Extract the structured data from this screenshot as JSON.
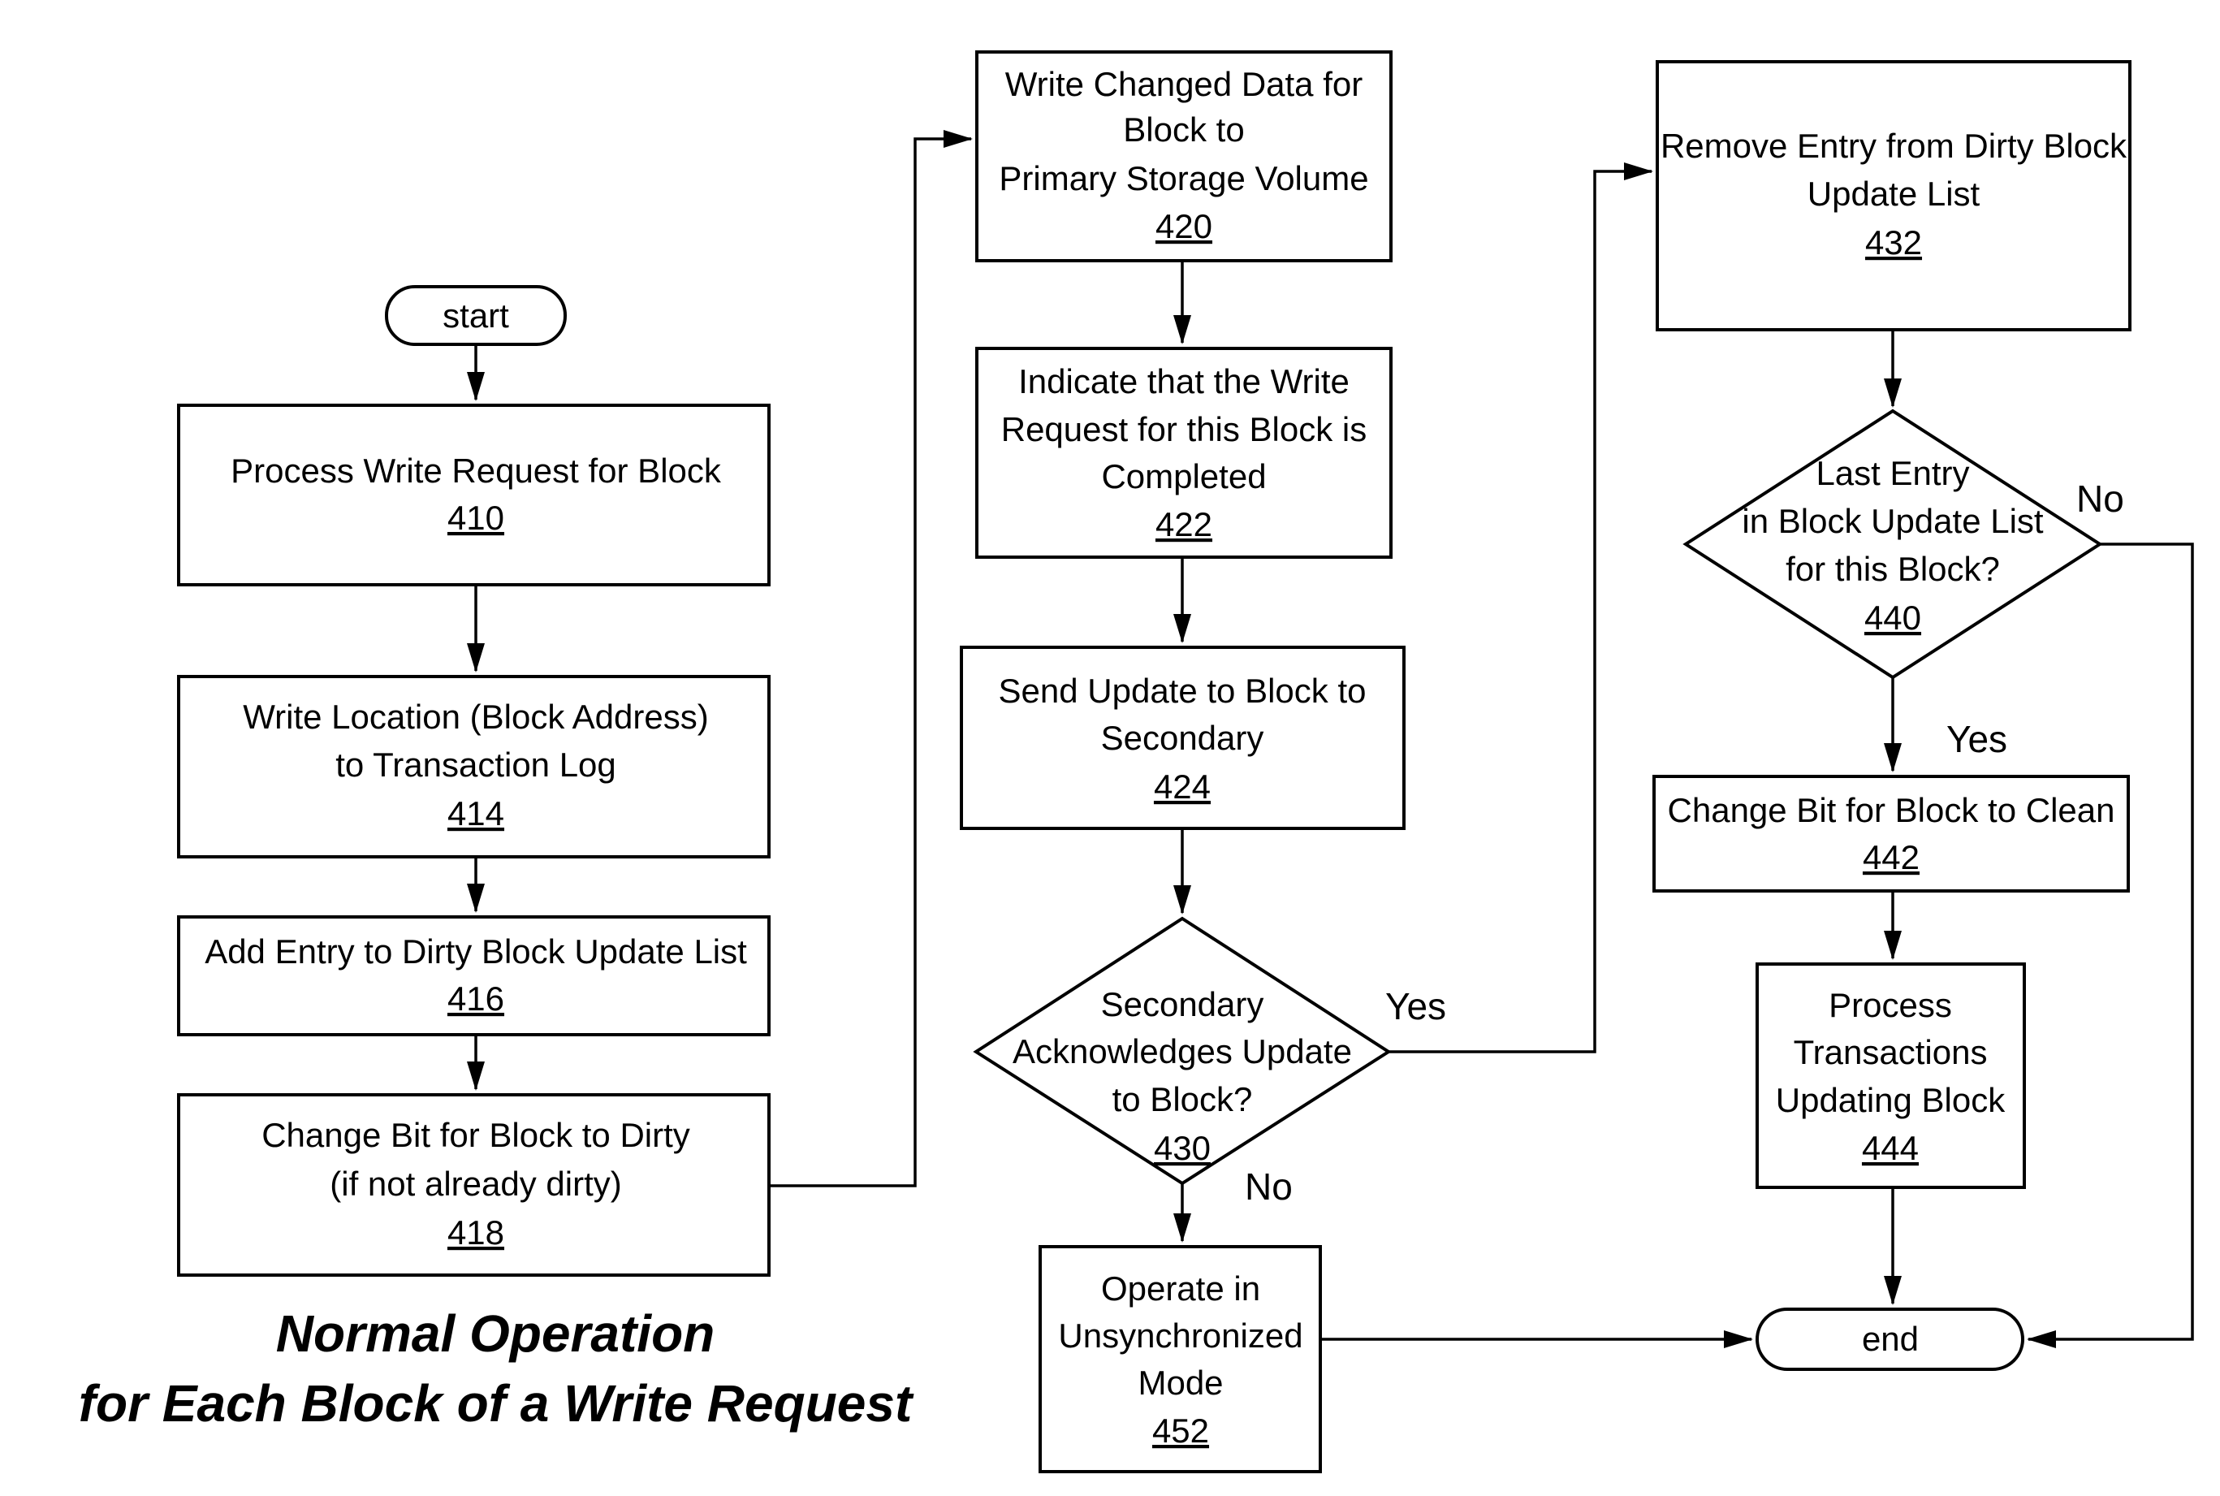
{
  "diagram": {
    "title_lines": [
      "Normal Operation",
      "for Each Block of a Write Request"
    ],
    "nodes": {
      "start": {
        "label": "start"
      },
      "n410": {
        "lines": [
          "Process Write Request  for Block"
        ],
        "ref": "410"
      },
      "n414": {
        "lines": [
          "Write Location (Block Address)",
          "to Transaction Log"
        ],
        "ref": "414"
      },
      "n416": {
        "lines": [
          "Add Entry to Dirty Block Update List"
        ],
        "ref": "416"
      },
      "n418": {
        "lines": [
          "Change Bit for Block to Dirty",
          "(if not already dirty)"
        ],
        "ref": "418"
      },
      "n420": {
        "lines": [
          "Write Changed Data for",
          "Block to",
          "Primary Storage Volume"
        ],
        "ref": "420"
      },
      "n422": {
        "lines": [
          "Indicate that the Write",
          "Request for this Block is",
          "Completed"
        ],
        "ref": "422"
      },
      "n424": {
        "lines": [
          "Send Update to Block to",
          "Secondary"
        ],
        "ref": "424"
      },
      "n430": {
        "lines": [
          "Secondary",
          "Acknowledges Update",
          "to Block?"
        ],
        "ref": "430"
      },
      "n452": {
        "lines": [
          "Operate in",
          "Unsynchronized",
          "Mode"
        ],
        "ref": "452"
      },
      "n432": {
        "lines": [
          "Remove Entry from Dirty Block",
          "Update List"
        ],
        "ref": "432"
      },
      "n440": {
        "lines": [
          "Last Entry",
          "in Block Update List",
          "for this Block?"
        ],
        "ref": "440"
      },
      "n442": {
        "lines": [
          "Change Bit for Block to Clean"
        ],
        "ref": "442"
      },
      "n444": {
        "lines": [
          "Process",
          "Transactions",
          "Updating Block"
        ],
        "ref": "444"
      },
      "end": {
        "label": "end"
      }
    },
    "edge_labels": {
      "n430_yes": "Yes",
      "n430_no": "No",
      "n440_yes": "Yes",
      "n440_no": "No"
    }
  }
}
